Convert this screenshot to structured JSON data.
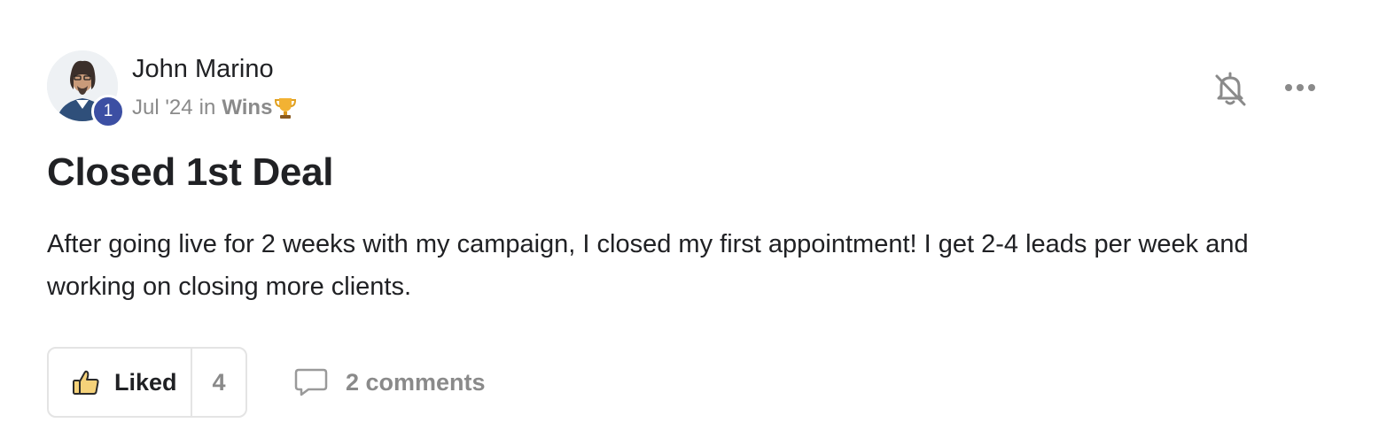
{
  "post": {
    "author": {
      "name": "John Marino",
      "level": "1",
      "avatar_icon": "person-photo-icon"
    },
    "meta": {
      "date": "Jul '24",
      "separator": "in",
      "category": "Wins",
      "category_icon": "trophy-icon"
    },
    "actions": {
      "mute_icon": "bell-slash-icon",
      "more_icon": "ellipsis-icon"
    },
    "title": "Closed 1st Deal",
    "body": "After going live for 2 weeks with my campaign, I closed my first appointment! I get 2-4 leads per week and working on closing more clients.",
    "like": {
      "label": "Liked",
      "count": "4",
      "icon": "thumbs-up-icon"
    },
    "comments": {
      "label": "2 comments",
      "icon": "comment-bubble-icon"
    }
  },
  "colors": {
    "badge": "#3c4fa3",
    "muted_text": "#8a8a8a",
    "border": "#e4e4e4",
    "thumb_fill": "#f5d27a"
  }
}
